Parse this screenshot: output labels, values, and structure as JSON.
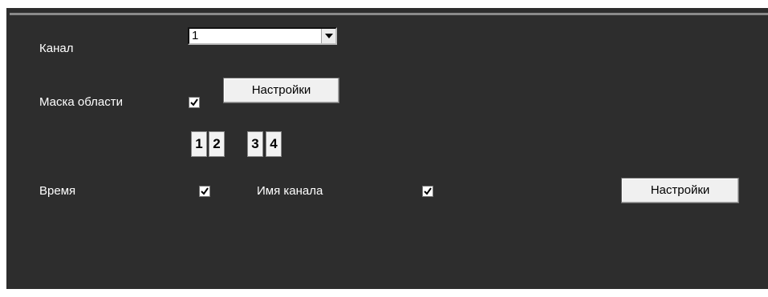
{
  "channel": {
    "label": "Канал",
    "selected": "1"
  },
  "mask": {
    "label": "Маска области",
    "checked": true,
    "settings_label": "Настройки",
    "tabs": [
      "1",
      "2",
      "3",
      "4"
    ]
  },
  "time": {
    "label": "Время",
    "checked": true
  },
  "channel_name": {
    "label": "Имя канала",
    "checked": true
  },
  "overlay_settings_label": "Настройки",
  "colors": {
    "panel_bg": "#2d2d2d",
    "text": "#ffffff"
  }
}
